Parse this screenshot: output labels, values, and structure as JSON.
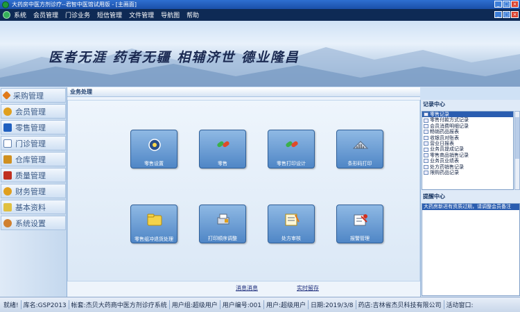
{
  "window": {
    "title": "大药房中医方剂诊疗--君智中医馆试用版 - [主画面]"
  },
  "menubar": {
    "items": [
      "系统",
      "会员管理",
      "门诊业务",
      "短信管理",
      "文件管理",
      "导航图",
      "帮助"
    ]
  },
  "banner": {
    "slogan": "医者无涯  药者无疆  相辅济世  德业隆昌"
  },
  "sidebar": {
    "items": [
      {
        "label": "采购管理",
        "icon": "diamond-icon",
        "color": "#e07a1a"
      },
      {
        "label": "会员管理",
        "icon": "member-icon",
        "color": "#e0a020"
      },
      {
        "label": "零售管理",
        "icon": "retail-icon",
        "color": "#2060c0"
      },
      {
        "label": "门诊管理",
        "icon": "clinic-icon",
        "color": "#6080b0"
      },
      {
        "label": "仓库管理",
        "icon": "warehouse-icon",
        "color": "#d09020"
      },
      {
        "label": "质量管理",
        "icon": "quality-icon",
        "color": "#c03020"
      },
      {
        "label": "财务管理",
        "icon": "finance-icon",
        "color": "#e0a020"
      },
      {
        "label": "基本资料",
        "icon": "folder-icon",
        "color": "#e0c040"
      },
      {
        "label": "系统设置",
        "icon": "settings-icon",
        "color": "#d08030"
      }
    ]
  },
  "main": {
    "header": "业务处理",
    "tiles": [
      {
        "label": "零售设置",
        "icon": "settings-icon"
      },
      {
        "label": "零售",
        "icon": "pills-icon"
      },
      {
        "label": "零售打印设计",
        "icon": "pills-icon"
      },
      {
        "label": "条形码打印",
        "icon": "barcode-printer-icon"
      },
      {
        "label": "零售组冲退货处理",
        "icon": "folder-icon"
      },
      {
        "label": "打印顺序调整",
        "icon": "print-order-icon"
      },
      {
        "label": "处方审核",
        "icon": "prescription-icon"
      },
      {
        "label": "报警管理",
        "icon": "alarm-icon"
      }
    ],
    "links": [
      "消息消息",
      "实时留存"
    ]
  },
  "right_panel": {
    "records_title": "记录中心",
    "records": [
      "零售记录",
      "零售付款方式记录",
      "会员消费明细记录",
      "畅销药品报表",
      "收银员对账表",
      "营业日报表",
      "业务员提成记录",
      "零售商品销售记录",
      "业务员业绩表",
      "处方药销售记录",
      "限购药品记录"
    ],
    "reminder_title": "提醒中心",
    "reminders": [
      "大药房新进有资质过期，请调整会员备注"
    ]
  },
  "statusbar": {
    "segments": [
      "就绪!",
      "库名:GSP2013",
      "帐套:杰贝大药商中医方剂诊疗系统",
      "用户组:超级用户",
      "用户编号:001",
      "用户:超级用户",
      "日期:2019/3/8",
      "药店:吉林省杰贝科技有限公司",
      "活动窗口:"
    ]
  },
  "colors": {
    "menubar_bg": "#0e2a55",
    "tile_bg": "#4f86c6",
    "selection": "#2a5db0"
  }
}
